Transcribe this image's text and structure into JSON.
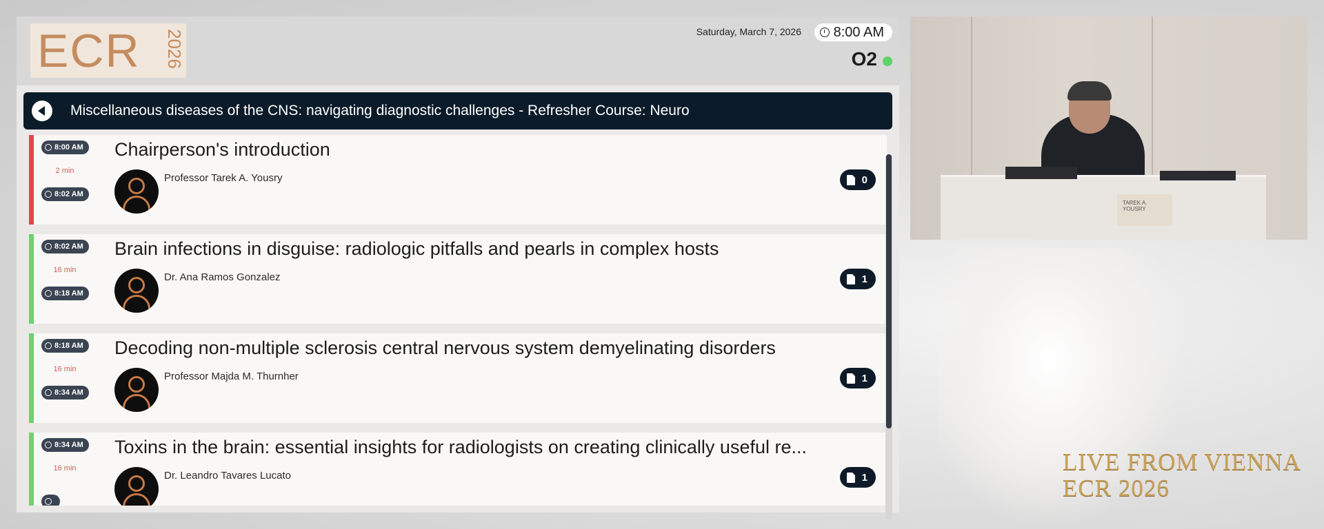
{
  "header": {
    "logo": "ECR 2026",
    "date": "Saturday, March 7, 2026",
    "time": "8:00 AM",
    "room": "O2",
    "room_status_color": "#5bd46a"
  },
  "session": {
    "title": "Miscellaneous diseases of the CNS: navigating diagnostic challenges - Refresher Course: Neuro"
  },
  "items": [
    {
      "start": "8:00 AM",
      "duration": "2 min",
      "end": "8:02 AM",
      "title": "Chairperson's introduction",
      "speaker": "Professor Tarek A. Yousry",
      "documents": "0",
      "status_color": "#e0474c"
    },
    {
      "start": "8:02 AM",
      "duration": "16 min",
      "end": "8:18 AM",
      "title": "Brain infections in disguise: radiologic pitfalls and pearls in complex hosts",
      "speaker": "Dr. Ana Ramos Gonzalez",
      "documents": "1",
      "status_color": "#6bd36f"
    },
    {
      "start": "8:18 AM",
      "duration": "16 min",
      "end": "8:34 AM",
      "title": "Decoding non-multiple sclerosis central nervous system demyelinating disorders",
      "speaker": "Professor Majda M. Thurnher",
      "documents": "1",
      "status_color": "#6bd36f"
    },
    {
      "start": "8:34 AM",
      "duration": "16 min",
      "end": "",
      "title": "Toxins in the brain: essential insights for radiologists on creating clinically useful re...",
      "speaker": "Dr. Leandro Tavares Lucato",
      "documents": "1",
      "status_color": "#6bd36f"
    }
  ],
  "video": {
    "nameplate": "TAREK A. YOUSRY"
  },
  "branding": {
    "live_line1": "LIVE FROM VIENNA",
    "live_line2": "ECR 2026"
  }
}
